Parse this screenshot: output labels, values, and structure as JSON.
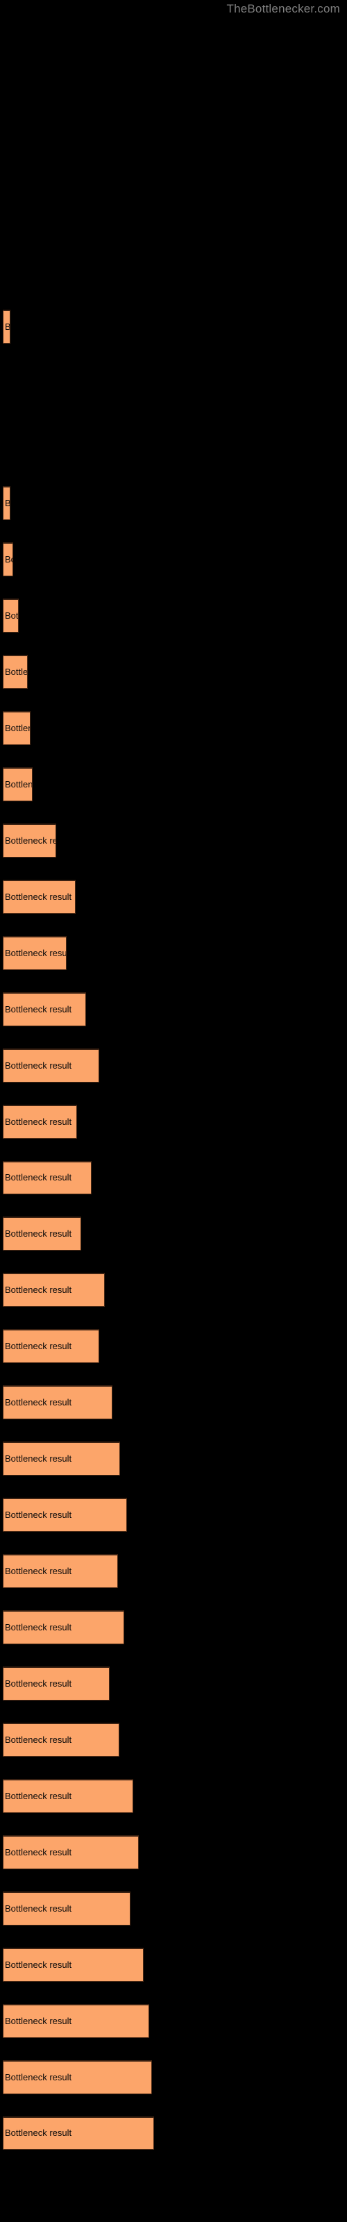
{
  "watermark": {
    "text": "TheBottlenecker.com"
  },
  "colors": {
    "background": "#000000",
    "bar_fill": "#fca56a",
    "bar_edge": "#3a2112",
    "label_text": "#0a0a0a",
    "watermark_text": "#808080"
  },
  "chart_data": {
    "type": "bar",
    "orientation": "horizontal",
    "title": "",
    "subtitle": "",
    "xlabel": "",
    "ylabel": "",
    "grid": false,
    "legend": null,
    "axis_visible": false,
    "tick_labels_visible": false,
    "bar_label_text": "Bottleneck result",
    "xlim": [
      0,
      500
    ],
    "categories": [
      "bar-1",
      "bar-2",
      "bar-3",
      "bar-4",
      "bar-5",
      "bar-6",
      "bar-7",
      "bar-8",
      "bar-9",
      "bar-10",
      "bar-11",
      "bar-12",
      "bar-13",
      "bar-14",
      "bar-15",
      "bar-16",
      "bar-17",
      "bar-18",
      "bar-19",
      "bar-20",
      "bar-21",
      "bar-22",
      "bar-23",
      "bar-24",
      "bar-25",
      "bar-26",
      "bar-27",
      "bar-28",
      "bar-29",
      "bar-30",
      "bar-31"
    ],
    "values": [
      6,
      6,
      8,
      12,
      19,
      21,
      23,
      41,
      56,
      49,
      64,
      74,
      57,
      68,
      60,
      78,
      74,
      84,
      90,
      95,
      88,
      93,
      82,
      89,
      100,
      104,
      98,
      108,
      112,
      114,
      116
    ],
    "bars": [
      {
        "name": "bar-1",
        "y": 237,
        "height": 26,
        "width": 6,
        "label": ""
      },
      {
        "name": "bar-2",
        "y": 372,
        "height": 26,
        "width": 6,
        "label": ""
      },
      {
        "name": "bar-3",
        "y": 415,
        "height": 26,
        "width": 8,
        "label": ""
      },
      {
        "name": "bar-4",
        "y": 458,
        "height": 26,
        "width": 12,
        "label": "B"
      },
      {
        "name": "bar-5",
        "y": 501,
        "height": 26,
        "width": 19,
        "label": "Bo"
      },
      {
        "name": "bar-6",
        "y": 544,
        "height": 26,
        "width": 21,
        "label": "Ba"
      },
      {
        "name": "bar-7",
        "y": 587,
        "height": 26,
        "width": 23,
        "label": "Bo"
      },
      {
        "name": "bar-8",
        "y": 630,
        "height": 26,
        "width": 41,
        "label": "Bottlene"
      },
      {
        "name": "bar-9",
        "y": 673,
        "height": 26,
        "width": 56,
        "label": "Bottleneck re"
      },
      {
        "name": "bar-10",
        "y": 716,
        "height": 26,
        "width": 49,
        "label": "Bottleneck"
      },
      {
        "name": "bar-11",
        "y": 759,
        "height": 26,
        "width": 64,
        "label": "Bottleneck res"
      },
      {
        "name": "bar-12",
        "y": 802,
        "height": 26,
        "width": 74,
        "label": "Bottleneck result"
      },
      {
        "name": "bar-13",
        "y": 845,
        "height": 26,
        "width": 57,
        "label": "Bottleneck re"
      },
      {
        "name": "bar-14",
        "y": 888,
        "height": 26,
        "width": 68,
        "label": "Bottleneck resu"
      },
      {
        "name": "bar-15",
        "y": 931,
        "height": 26,
        "width": 60,
        "label": "Bottleneck r"
      },
      {
        "name": "bar-16",
        "y": 974,
        "height": 26,
        "width": 78,
        "label": "Bottleneck result"
      },
      {
        "name": "bar-17",
        "y": 1017,
        "height": 26,
        "width": 74,
        "label": "Bottleneck res"
      },
      {
        "name": "bar-18",
        "y": 1060,
        "height": 26,
        "width": 84,
        "label": "Bottleneck result"
      },
      {
        "name": "bar-19",
        "y": 1103,
        "height": 26,
        "width": 90,
        "label": "Bottleneck result"
      },
      {
        "name": "bar-20",
        "y": 1146,
        "height": 26,
        "width": 95,
        "label": "Bottleneck result"
      },
      {
        "name": "bar-21",
        "y": 1189,
        "height": 26,
        "width": 88,
        "label": "Bottleneck result"
      },
      {
        "name": "bar-22",
        "y": 1232,
        "height": 26,
        "width": 93,
        "label": "Bottleneck result"
      },
      {
        "name": "bar-23",
        "y": 1275,
        "height": 26,
        "width": 82,
        "label": "Bottleneck result"
      },
      {
        "name": "bar-24",
        "y": 1318,
        "height": 26,
        "width": 89,
        "label": "Bottleneck result"
      },
      {
        "name": "bar-25",
        "y": 1361,
        "height": 26,
        "width": 100,
        "label": "Bottleneck result"
      },
      {
        "name": "bar-26",
        "y": 1404,
        "height": 26,
        "width": 104,
        "label": "Bottleneck result"
      },
      {
        "name": "bar-27",
        "y": 1447,
        "height": 26,
        "width": 98,
        "label": "Bottleneck result"
      },
      {
        "name": "bar-28",
        "y": 1490,
        "height": 26,
        "width": 108,
        "label": "Bottleneck result"
      },
      {
        "name": "bar-29",
        "y": 1533,
        "height": 26,
        "width": 112,
        "label": "Bottleneck result"
      },
      {
        "name": "bar-30",
        "y": 1576,
        "height": 26,
        "width": 114,
        "label": "Bottleneck result"
      },
      {
        "name": "bar-31",
        "y": 1619,
        "height": 26,
        "width": 116,
        "label": "Bottleneck result"
      }
    ]
  },
  "render": {
    "bars": [
      {
        "name": "bar-1",
        "top": 237,
        "h": 26,
        "w": 6,
        "label": ""
      },
      {
        "name": "bar-2",
        "top": 372,
        "h": 26,
        "w": 6,
        "label": ""
      },
      {
        "name": "bar-3",
        "top": 415,
        "h": 26,
        "w": 9,
        "label": ""
      },
      {
        "name": "bar-4",
        "top": 458,
        "h": 26,
        "w": 13,
        "label": "B"
      },
      {
        "name": "bar-5",
        "top": 501,
        "h": 26,
        "w": 19,
        "label": "Bo"
      },
      {
        "name": "bar-6",
        "top": 544,
        "h": 26,
        "w": 20,
        "label": "Ba"
      },
      {
        "name": "bar-7",
        "top": 587,
        "h": 26,
        "w": 22,
        "label": "Bo"
      },
      {
        "name": "bar-8",
        "top": 630,
        "h": 26,
        "w": 40,
        "label": "Bottleneck result"
      },
      {
        "name": "bar-9",
        "top": 673,
        "h": 26,
        "w": 56,
        "label": "Bottleneck result"
      },
      {
        "name": "bar-10",
        "top": 716,
        "h": 26,
        "w": 47,
        "label": "Bottleneck result"
      },
      {
        "name": "bar-11",
        "top": 759,
        "h": 26,
        "w": 64,
        "label": "Bottleneck result"
      },
      {
        "name": "bar-12",
        "top": 802,
        "h": 26,
        "w": 74,
        "label": "Bottleneck result"
      },
      {
        "name": "bar-13",
        "top": 845,
        "h": 26,
        "w": 57,
        "label": "Bottleneck result"
      },
      {
        "name": "bar-14",
        "top": 888,
        "h": 26,
        "w": 67,
        "label": "Bottleneck result"
      },
      {
        "name": "bar-15",
        "top": 931,
        "h": 26,
        "w": 59,
        "label": "Bottleneck result"
      },
      {
        "name": "bar-16",
        "top": 974,
        "h": 26,
        "w": 78,
        "label": "Bottleneck result"
      },
      {
        "name": "bar-17",
        "top": 1017,
        "h": 26,
        "w": 73,
        "label": "Bottleneck result"
      },
      {
        "name": "bar-18",
        "top": 1060,
        "h": 26,
        "w": 84,
        "label": "Bottleneck result"
      },
      {
        "name": "bar-19",
        "top": 1103,
        "h": 26,
        "w": 90,
        "label": "Bottleneck result"
      },
      {
        "name": "bar-20",
        "top": 1146,
        "h": 26,
        "w": 95,
        "label": "Bottleneck result"
      },
      {
        "name": "bar-21",
        "top": 1189,
        "h": 26,
        "w": 88,
        "label": "Bottleneck result"
      },
      {
        "name": "bar-22",
        "top": 1232,
        "h": 26,
        "w": 93,
        "label": "Bottleneck result"
      },
      {
        "name": "bar-23",
        "top": 1275,
        "h": 26,
        "w": 82,
        "label": "Bottleneck result"
      },
      {
        "name": "bar-24",
        "top": 1318,
        "h": 26,
        "w": 89,
        "label": "Bottleneck result"
      },
      {
        "name": "bar-25",
        "top": 1361,
        "h": 26,
        "w": 100,
        "label": "Bottleneck result"
      },
      {
        "name": "bar-26",
        "top": 1404,
        "h": 26,
        "w": 104,
        "label": "Bottleneck result"
      },
      {
        "name": "bar-27",
        "top": 1447,
        "h": 26,
        "w": 98,
        "label": "Bottleneck result"
      },
      {
        "name": "bar-28",
        "top": 1490,
        "h": 26,
        "w": 108,
        "label": "Bottleneck result"
      },
      {
        "name": "bar-29",
        "top": 1533,
        "h": 26,
        "w": 112,
        "label": "Bottleneck result"
      },
      {
        "name": "bar-30",
        "top": 1576,
        "h": 26,
        "w": 114,
        "label": "Bottleneck result"
      },
      {
        "name": "bar-31",
        "top": 1619,
        "h": 26,
        "w": 116,
        "label": "Bottleneck result"
      }
    ]
  }
}
